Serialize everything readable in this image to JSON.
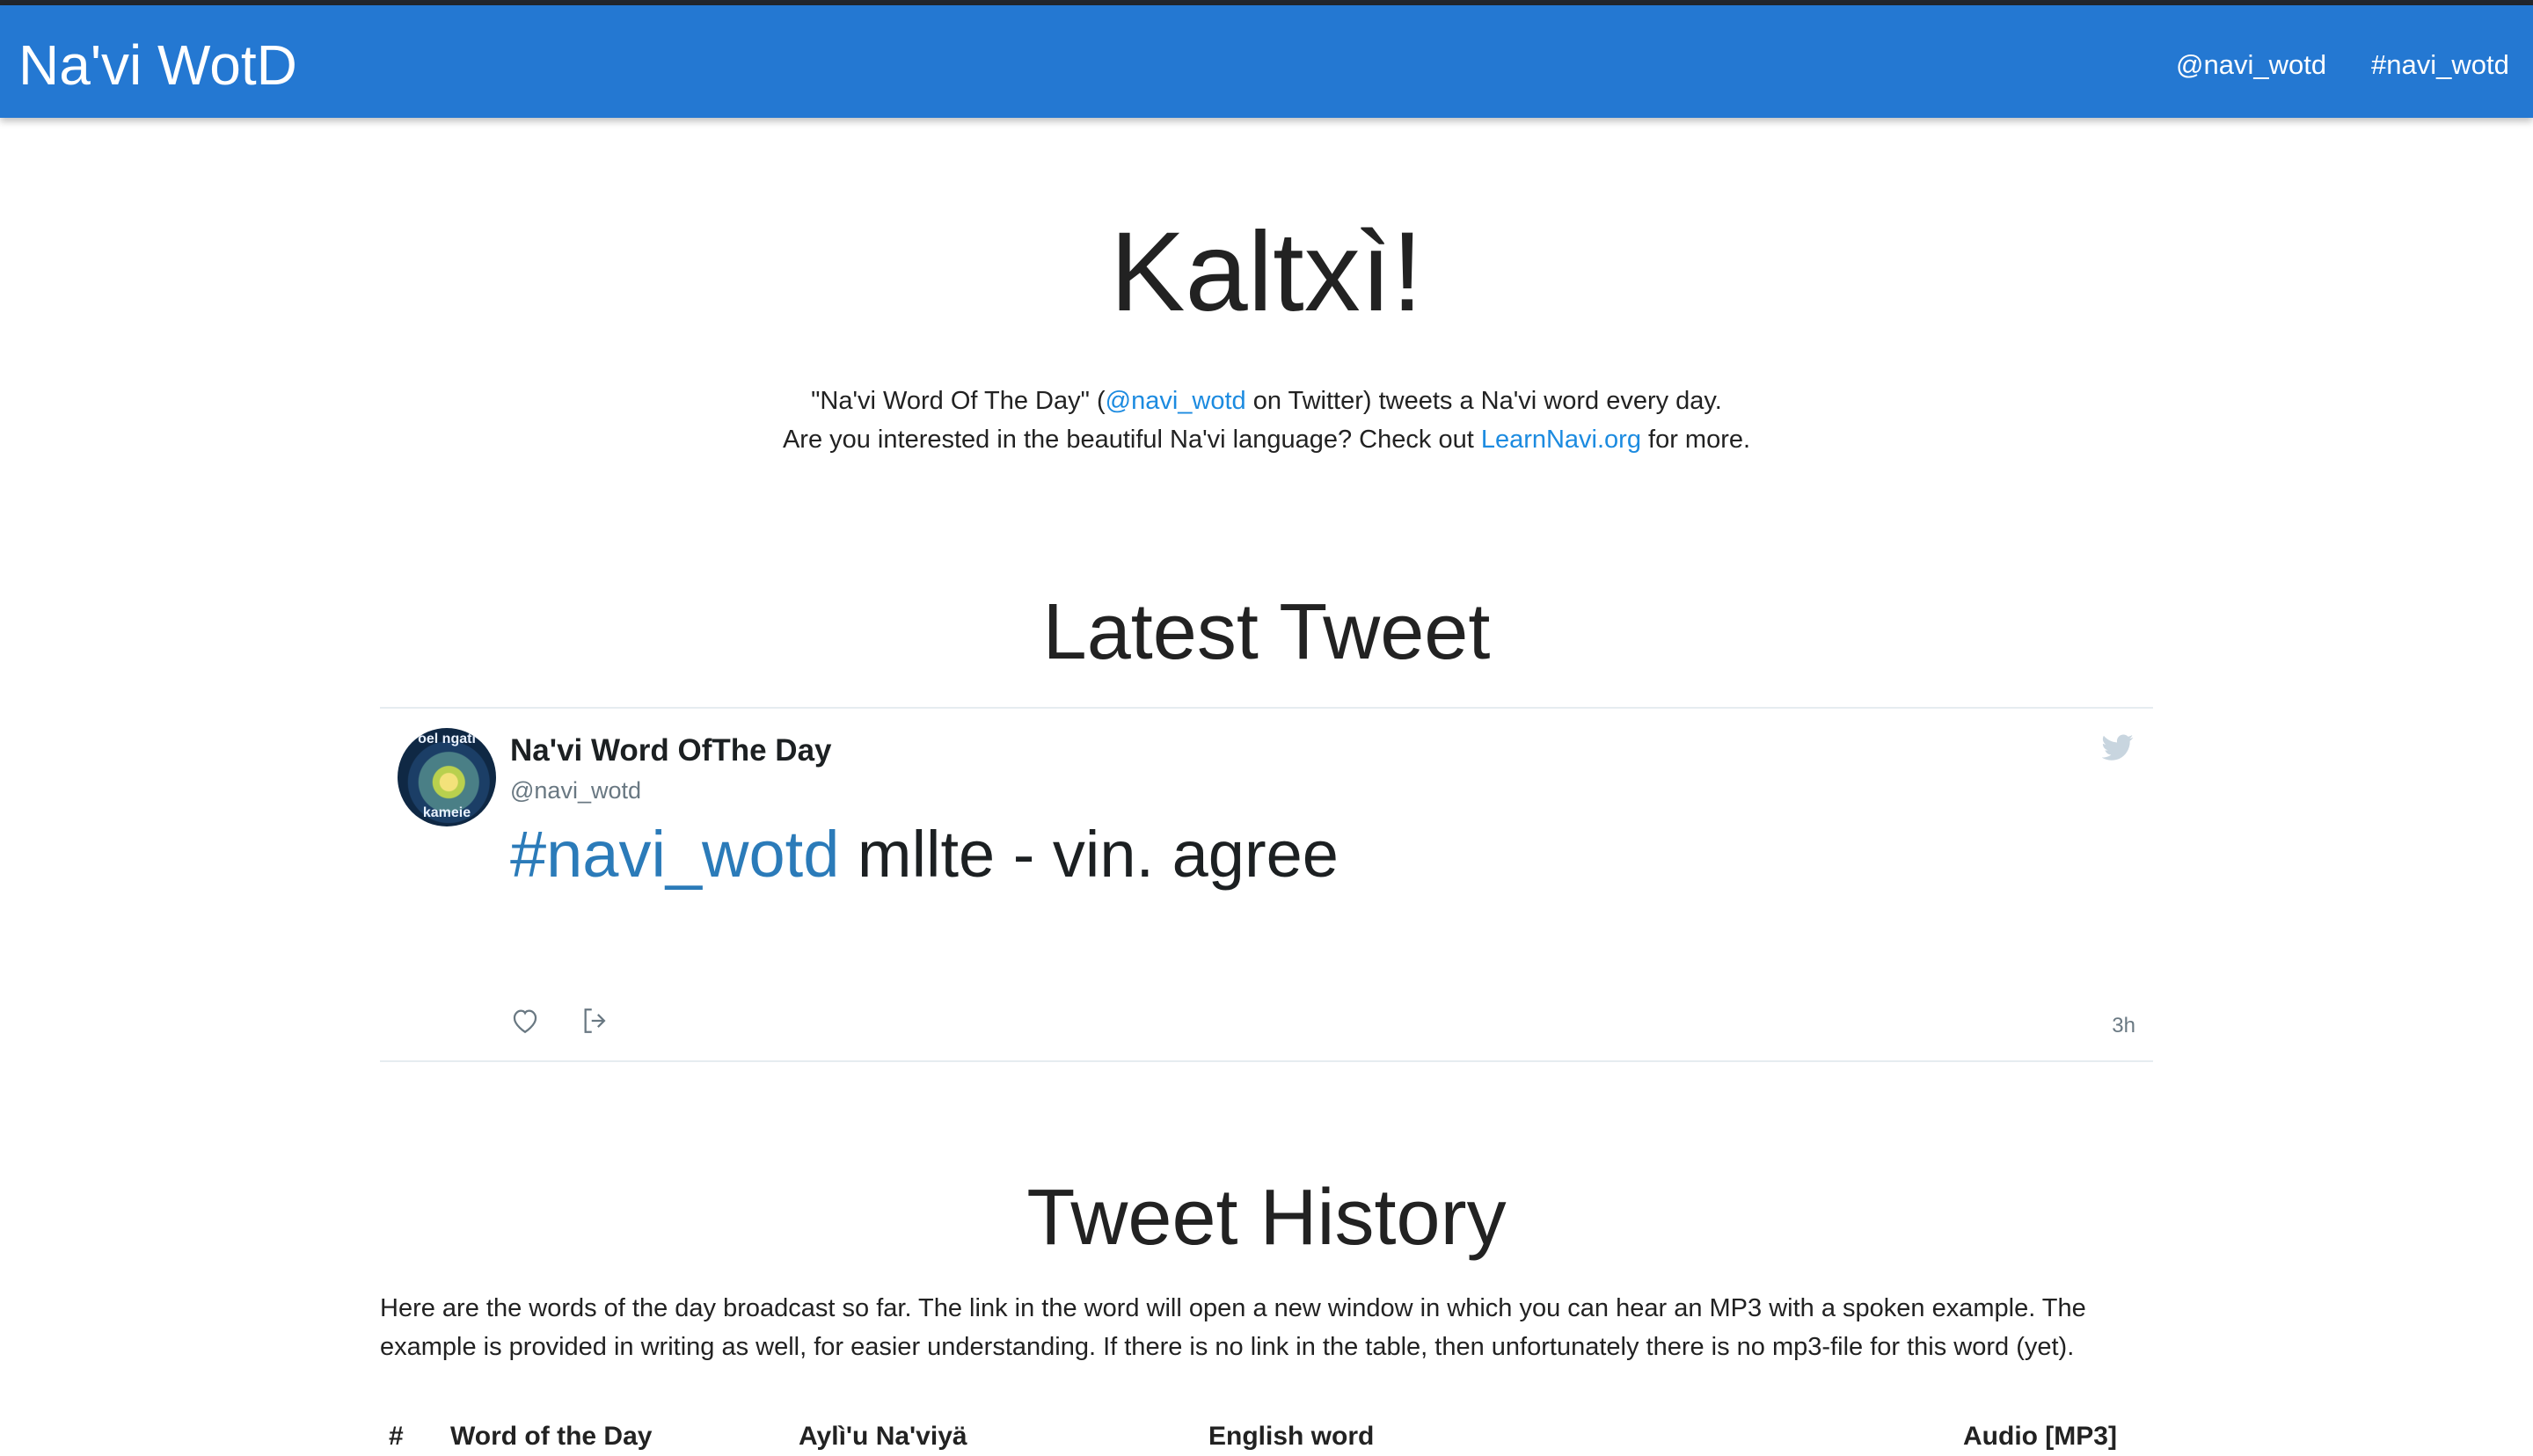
{
  "navbar": {
    "brand": "Na'vi WotD",
    "links": [
      "@navi_wotd",
      "#navi_wotd"
    ],
    "color": "#2478d2"
  },
  "hero": {
    "title": "Kaltxì!",
    "line1_pre": "\"Na'vi Word Of The Day\" (",
    "line1_link": "@navi_wotd",
    "line1_post": " on Twitter) tweets a Na'vi word every day.",
    "line2_pre": "Are you interested in the beautiful Na'vi language? Check out ",
    "line2_link": "LearnNavi.org",
    "line2_post": " for more."
  },
  "latest": {
    "title": "Latest Tweet",
    "tweet": {
      "name": "Na'vi Word OfThe Day",
      "handle": "@navi_wotd",
      "hashtag": "#navi_wotd",
      "text": " mllte - vin. agree",
      "time": "3h",
      "avatar_top": "oel ngati",
      "avatar_bottom": "kameie",
      "icons": [
        "twitter-bird-icon",
        "heart-icon",
        "share-icon"
      ]
    }
  },
  "history": {
    "title": "Tweet History",
    "description": "Here are the words of the day broadcast so far. The link in the word will open a new window in which you can hear an MP3 with a spoken example. The example is provided in writing as well, for easier understanding. If there is no link in the table, then unfortunately there is no mp3-file for this word (yet).",
    "columns": [
      "#",
      "Word of the Day",
      "Aylì'u Na'viyä",
      "English word",
      "Audio [MP3]"
    ]
  }
}
